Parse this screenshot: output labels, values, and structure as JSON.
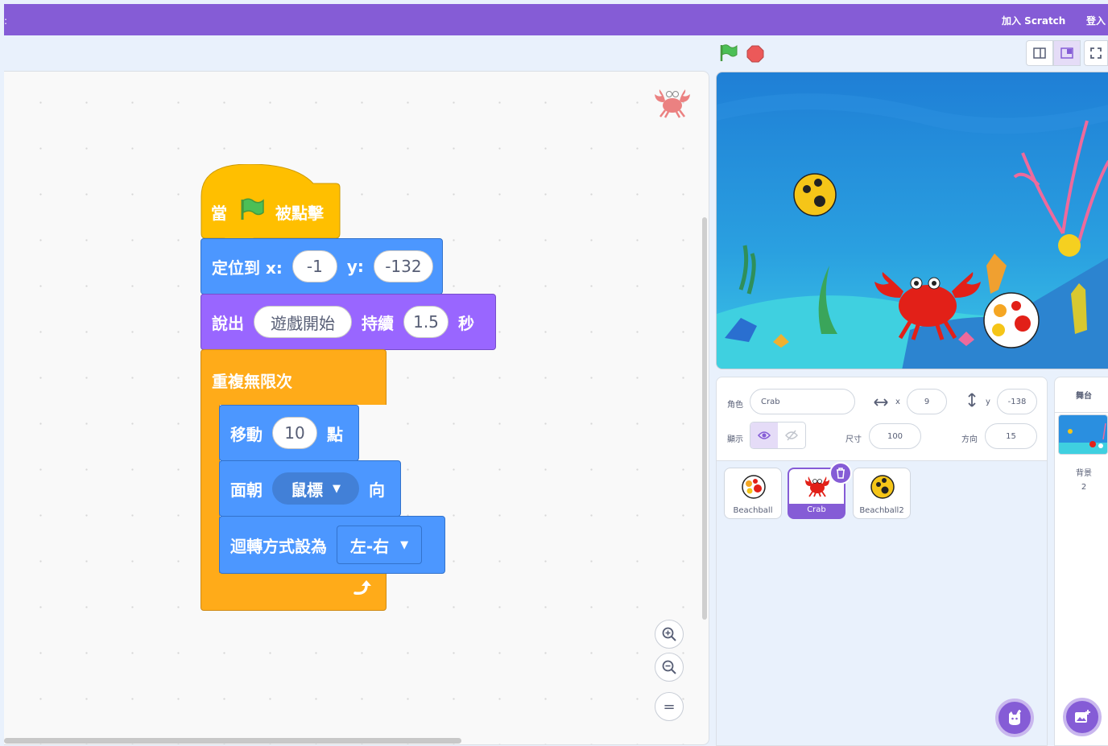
{
  "menubar": {
    "join_label": "加入 Scratch",
    "signin_label": "登入",
    "menu_marker": ":"
  },
  "blocks": {
    "hat": {
      "when": "當",
      "clicked": "被點擊"
    },
    "goto": {
      "label": "定位到 x:",
      "x": "-1",
      "y_label": "y:",
      "y": "-132"
    },
    "say": {
      "label": "說出",
      "text": "遊戲開始",
      "for_label": "持續",
      "secs": "1.5",
      "secs_label": "秒"
    },
    "forever": {
      "label": "重複無限次"
    },
    "move": {
      "label": "移動",
      "steps": "10",
      "steps_label": "點"
    },
    "point": {
      "label": "面朝",
      "target": "鼠標",
      "towards_label": "向"
    },
    "rotation": {
      "label": "迴轉方式設為",
      "style": "左-右"
    }
  },
  "zoom": {
    "in": "+",
    "out": "−",
    "reset": "="
  },
  "sprite_info": {
    "sprite_label": "角色",
    "sprite_name": "Crab",
    "x_label": "x",
    "x": "9",
    "y_label": "y",
    "y": "-138",
    "show_label": "顯示",
    "size_label": "尺寸",
    "size": "100",
    "direction_label": "方向",
    "direction": "15"
  },
  "sprites": [
    {
      "name": "Beachball",
      "selected": false
    },
    {
      "name": "Crab",
      "selected": true
    },
    {
      "name": "Beachball2",
      "selected": false
    }
  ],
  "stage_panel": {
    "title": "舞台",
    "backdrops_label": "背景",
    "backdrops_count": "2"
  },
  "colors": {
    "motion": "#4c97ff",
    "looks": "#9966ff",
    "control": "#ffab19",
    "events": "#ffbf00",
    "accent": "#855cd6"
  }
}
